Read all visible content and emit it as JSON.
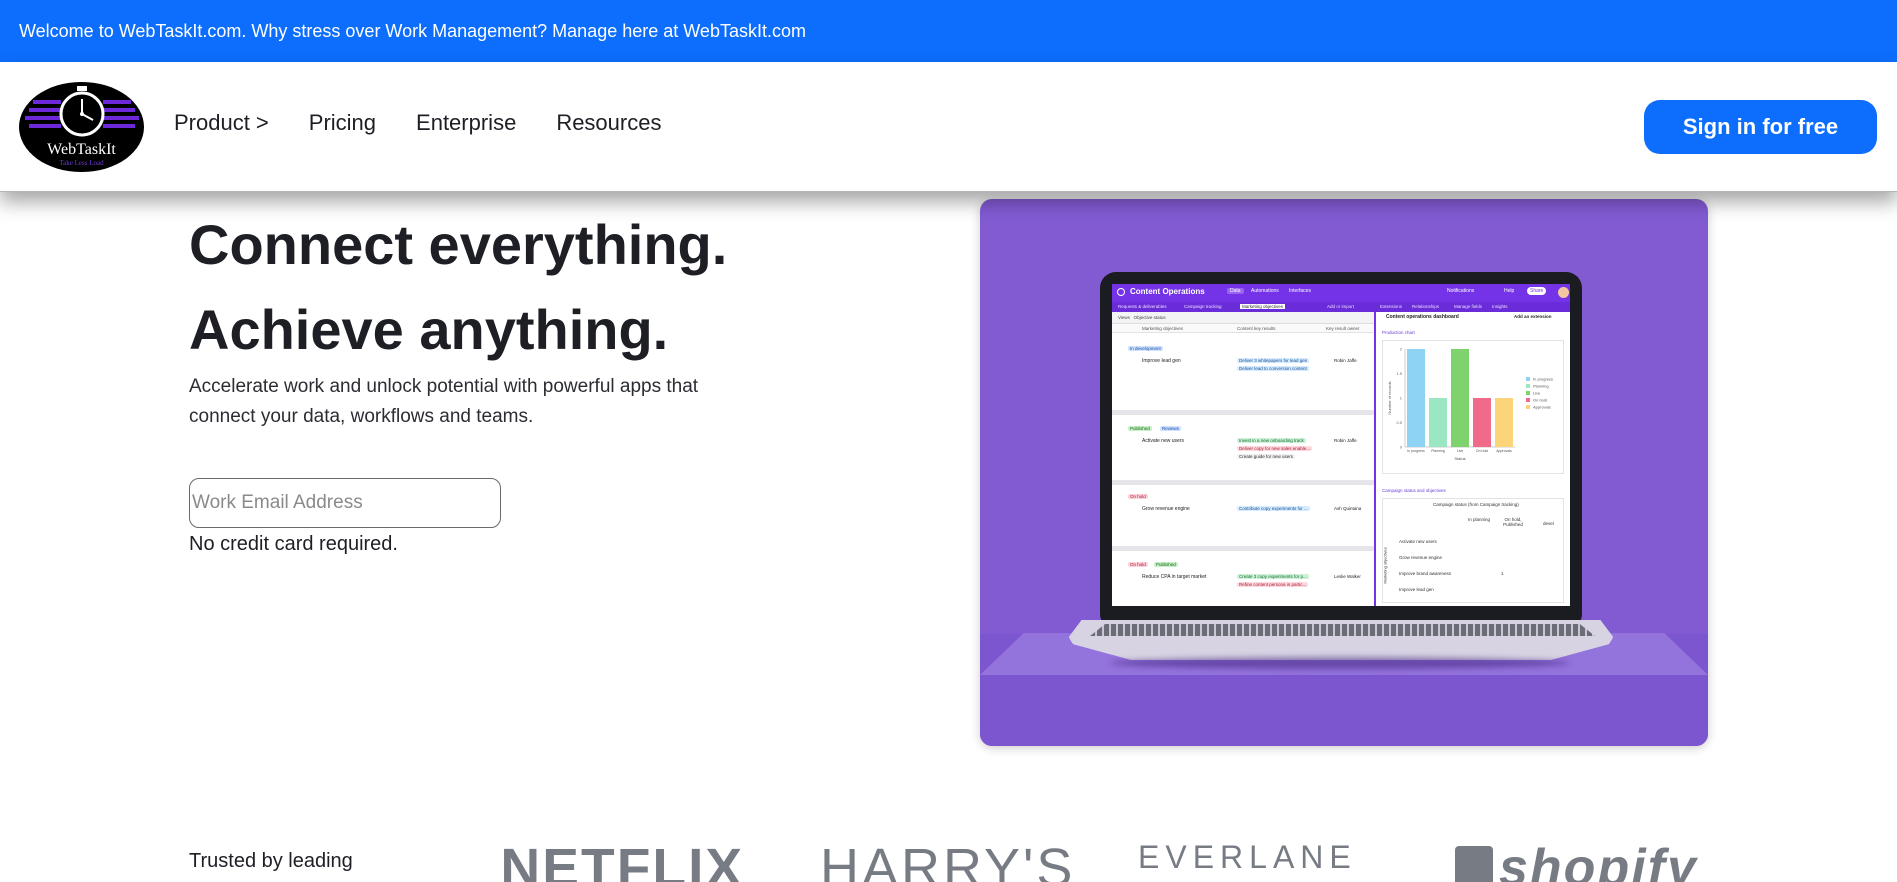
{
  "announcement": "Welcome to WebTaskIt.com. Why stress over Work Management? Manage here at WebTaskIt.com",
  "logo": {
    "name": "WebTaskIt",
    "tagline": "Take Less Load"
  },
  "nav": {
    "product": "Product >",
    "pricing": "Pricing",
    "enterprise": "Enterprise",
    "resources": "Resources",
    "signin": "Sign in for free"
  },
  "hero": {
    "title1": "Connect everything.",
    "title2": "Achieve anything.",
    "subtitle": "Accelerate work and unlock potential with powerful apps that connect your data, workflows and teams.",
    "email_placeholder": "Work Email Address",
    "no_card": "No credit card required."
  },
  "screenshot_app": {
    "title": "Content Operations",
    "tabs": [
      "Data",
      "Automations",
      "Interfaces"
    ],
    "header_right": [
      "Notifications",
      "Help",
      "Share"
    ],
    "subtabs": [
      "Requests & deliverables",
      "Campaign tracking",
      "Marketing objectives",
      "Add or import",
      "Extensions",
      "Relationships",
      "Manage fields",
      "Insights"
    ],
    "toolbar": "Views   Objective status",
    "columns": [
      "Marketing objectives",
      "Content key results",
      "Key result owner"
    ],
    "groups": [
      {
        "status": "In development",
        "row": "Improve lead gen",
        "results": [
          "Deliver 3 whitepapers for lead gen",
          "Deliver lead to conversion content"
        ],
        "owner": "Robin Jaffe"
      },
      {
        "status": "Published",
        "status2": "Reviews",
        "row": "Activate new users",
        "results": [
          "Invest in a new onboarding track",
          "Deliver copy for new sales enable...",
          "Create guide for new users"
        ],
        "owner": "Robin Jaffe"
      },
      {
        "status": "On hold",
        "row": "Grow revenue engine",
        "results": [
          "Contribute copy experiments for ..."
        ],
        "owner": "Ash Quintana"
      },
      {
        "status": "On hold",
        "status2": "Published",
        "row": "Reduce CPA in target market",
        "results": [
          "Create 3 copy experiments for p...",
          "Refine content persona in partic..."
        ],
        "owner": "Leslie Walker"
      }
    ],
    "panel_title": "Content operations dashboard",
    "panel_action": "Add an extension",
    "chart_label": "Production chart",
    "table_label": "Campaign status and objectives",
    "table_title": "Campaign status (from Campaign tracking)",
    "table_cols": [
      "In planning",
      "On hold, Published",
      "devel"
    ],
    "table_rows": [
      "Activate new users",
      "Grow revenue engine",
      "Improve brand awareness",
      "Improve lead gen"
    ],
    "table_axis": "Marketing objectives",
    "table_value": "1"
  },
  "chart_data": {
    "type": "bar",
    "title": "",
    "categories": [
      "In progress",
      "Planning",
      "Live",
      "On hold",
      "Approvals"
    ],
    "values": [
      2,
      1,
      2,
      1,
      1
    ],
    "colors": [
      "#8fd3f4",
      "#9be7c4",
      "#7ed36f",
      "#f06a8a",
      "#fcd47a"
    ],
    "xlabel": "Status",
    "ylabel": "Number of records",
    "yticks": [
      "0",
      "0.5",
      "1",
      "1.5",
      "2"
    ],
    "ylim": [
      0,
      2
    ],
    "legend": [
      "In progress",
      "Planning",
      "Live",
      "On hold",
      "Approvals"
    ],
    "legend_position": "right"
  },
  "trusted": {
    "label": "Trusted by leading",
    "brands": [
      "NETFLIX",
      "HARRY'S",
      "EVERLANE",
      "shopify"
    ]
  },
  "colors": {
    "primary": "#0d6efd",
    "media_bg": "#825bd3",
    "app_purple": "#7433e6"
  }
}
